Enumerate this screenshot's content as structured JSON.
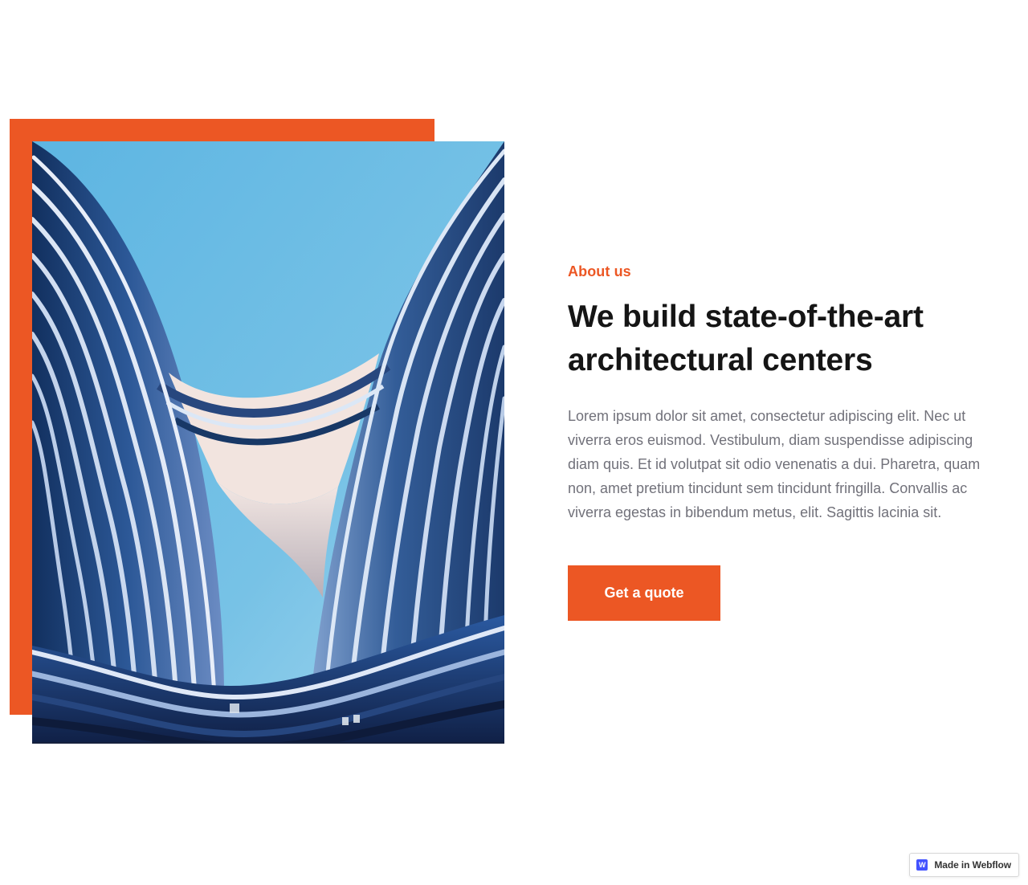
{
  "about": {
    "eyebrow": "About us",
    "heading": "We build state-of-the-art architectural centers",
    "body": "Lorem ipsum dolor sit amet, consectetur adipiscing elit. Nec ut viverra eros euismod. Vestibulum, diam suspendisse adipiscing diam quis. Et id volutpat sit odio venenatis a dui. Pharetra, quam non, amet pretium tincidunt sem tincidunt fringilla. Convallis ac viverra egestas in bibendum metus, elit. Sagittis lacinia sit.",
    "cta_label": "Get a quote"
  },
  "badge": {
    "label": "Made in Webflow",
    "logo_text": "W"
  },
  "colors": {
    "accent": "#ec5724",
    "heading": "#151515",
    "body": "#71717a",
    "webflow": "#4353ff"
  },
  "icons": {
    "webflow_logo": "webflow-logo-icon"
  }
}
